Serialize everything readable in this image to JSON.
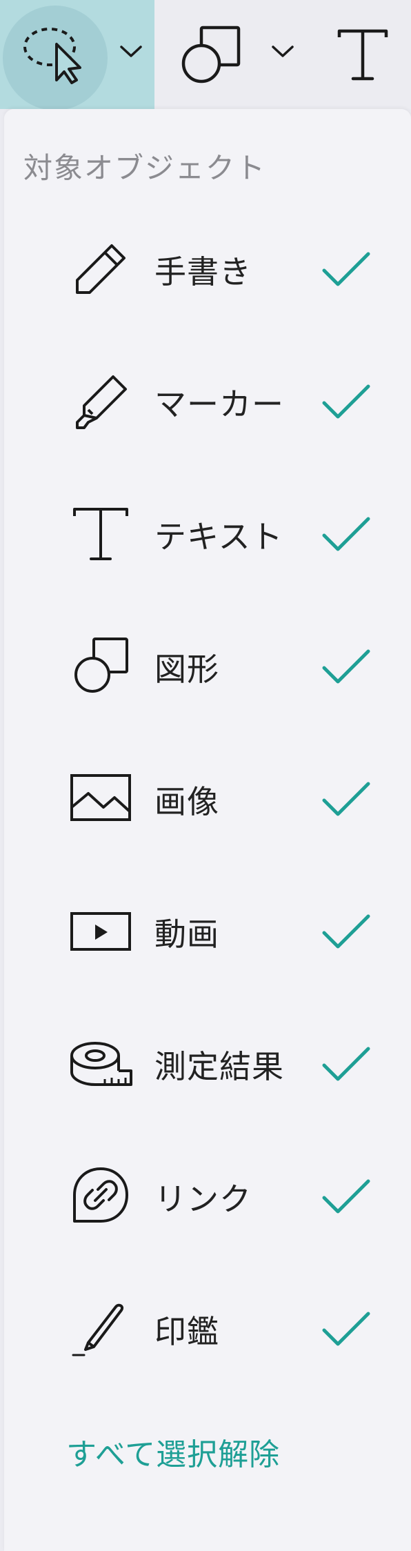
{
  "toolbar": {
    "tools": [
      {
        "name": "lasso-select",
        "icon": "lasso-select-icon",
        "active": true
      },
      {
        "name": "shape",
        "icon": "shape-icon",
        "active": false
      },
      {
        "name": "text",
        "icon": "text-icon",
        "active": false
      }
    ]
  },
  "panel": {
    "title": "対象オブジェクト",
    "items": [
      {
        "label": "手書き",
        "icon": "pencil-icon",
        "checked": true
      },
      {
        "label": "マーカー",
        "icon": "marker-icon",
        "checked": true
      },
      {
        "label": "テキスト",
        "icon": "text-icon",
        "checked": true
      },
      {
        "label": "図形",
        "icon": "shape-icon",
        "checked": true
      },
      {
        "label": "画像",
        "icon": "image-icon",
        "checked": true
      },
      {
        "label": "動画",
        "icon": "video-icon",
        "checked": true
      },
      {
        "label": "測定結果",
        "icon": "tape-measure-icon",
        "checked": true
      },
      {
        "label": "リンク",
        "icon": "link-icon",
        "checked": true
      },
      {
        "label": "印鑑",
        "icon": "stamp-pen-icon",
        "checked": true
      }
    ],
    "deselect_all": "すべて選択解除"
  },
  "colors": {
    "accent": "#1e9f95",
    "active_tool_bg": "#b3dbdf",
    "active_tool_circle": "#a3ced4",
    "panel_bg": "#f3f3f7",
    "title_gray": "#8b8b90"
  }
}
